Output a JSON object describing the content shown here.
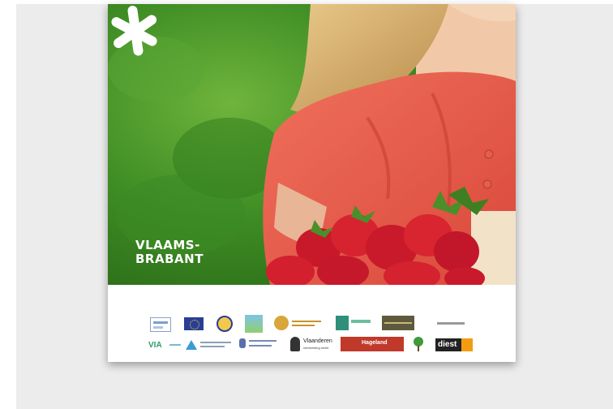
{
  "cover": {
    "brand_line1": "VLAAMS-",
    "brand_line2": "BRABANT"
  },
  "sponsor_logos": {
    "row1": [
      "leader-logo",
      "eu-flag-logo",
      "europe-seal-logo",
      "landscape-logo",
      "noord-hageland-logo",
      "regional-landscape-logo",
      "dark-panel-logo",
      "hagland-script-logo"
    ],
    "row2": {
      "via": "VIA",
      "vlaanderen": "Vlaanderen",
      "vlaanderen_sub": "verbeelding werkt",
      "hageland": "Hageland",
      "diest": "diest"
    }
  },
  "colors": {
    "background": "#ececec",
    "brand_white": "#ffffff",
    "hageland_red": "#c0392b",
    "diest_orange": "#f39c12"
  }
}
